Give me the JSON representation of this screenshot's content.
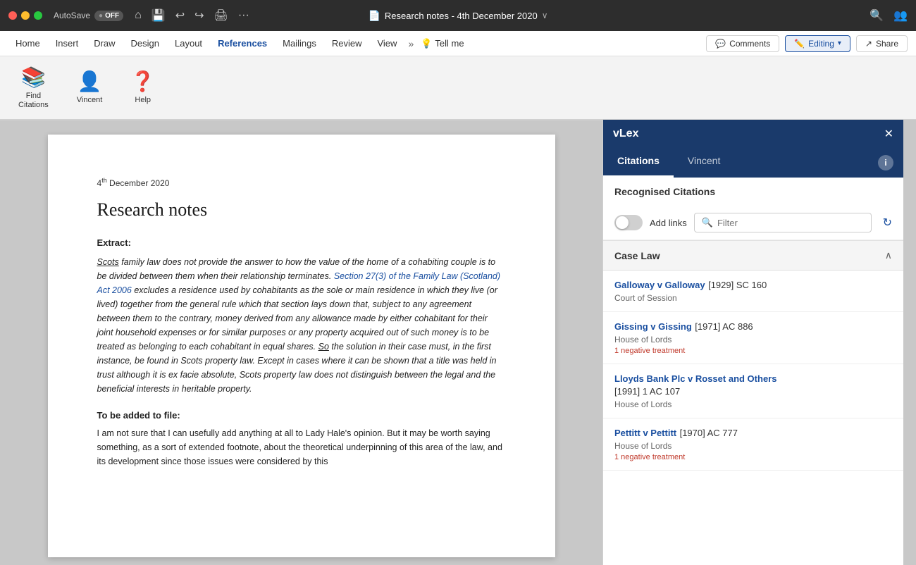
{
  "titlebar": {
    "autosave_label": "AutoSave",
    "autosave_state": "OFF",
    "title": "Research notes - 4th December 2020",
    "icons": [
      "🏠",
      "💾",
      "↩",
      "↪",
      "🖨",
      "···"
    ]
  },
  "menubar": {
    "items": [
      "Home",
      "Insert",
      "Draw",
      "Design",
      "Layout",
      "References",
      "Mailings",
      "Review",
      "View"
    ],
    "active": "References",
    "tell_me_placeholder": "Tell me",
    "buttons": [
      {
        "label": "Comments",
        "icon": "💬",
        "active": false
      },
      {
        "label": "Editing",
        "icon": "✏️",
        "active": true
      },
      {
        "label": "Share",
        "icon": "↗",
        "active": false
      }
    ]
  },
  "ribbon": {
    "buttons": [
      {
        "id": "find-citations",
        "label": "Find\nCitations",
        "icon": "📚"
      },
      {
        "id": "vincent",
        "label": "Vincent",
        "icon": "👤"
      },
      {
        "id": "help",
        "label": "Help",
        "icon": "❓"
      }
    ]
  },
  "document": {
    "date": "4",
    "date_suffix": "th",
    "date_rest": " December 2020",
    "title": "Research notes",
    "extract_label": "Extract:",
    "extract_body": "Scots family law does not provide the answer to how the value of the home of a cohabiting couple is to be divided between them when their relationship terminates. Section 27(3) of the Family Law (Scotland) Act 2006 excludes a residence used by cohabitants as the sole or main residence in which they live (or lived) together from the general rule which that section lays down that, subject to any agreement between them to the contrary, money derived from any allowance made by either cohabitant for their joint household expenses or for similar purposes or any property acquired out of such money is to be treated as belonging to each cohabitant in equal shares. So the solution in their case must, in the first instance, be found in Scots property law. Except in cases where it can be shown that a title was held in trust although it is ex facie absolute, Scots property law does not distinguish between the legal and the beneficial interests in heritable property.",
    "tobe_label": "To be added to file:",
    "tobe_body": "I am not sure that I can usefully add anything at all to Lady Hale's opinion. But it may be worth saying something, as a sort of extended footnote, about the theoretical underpinning of this area of the law, and its development since those issues were considered by this"
  },
  "sidepanel": {
    "title": "vLex",
    "tabs": [
      "Citations",
      "Vincent"
    ],
    "active_tab": "Citations",
    "section_title": "Recognised Citations",
    "add_links_label": "Add links",
    "filter_placeholder": "Filter",
    "case_law_title": "Case Law",
    "citations": [
      {
        "name": "Galloway v Galloway",
        "ref": " [1929] SC 160",
        "court": "Court of Session",
        "treatment": null
      },
      {
        "name": "Gissing v Gissing",
        "ref": " [1971] AC 886",
        "court": "House of Lords",
        "treatment": "1 negative treatment"
      },
      {
        "name": "Lloyds Bank Plc v Rosset and Others",
        "ref": " [1991] 1 AC 107",
        "court": "House of Lords",
        "treatment": null
      },
      {
        "name": "Pettitt v Pettitt",
        "ref": " [1970] AC 777",
        "court": "House of Lords",
        "treatment": "1 negative treatment"
      }
    ]
  }
}
